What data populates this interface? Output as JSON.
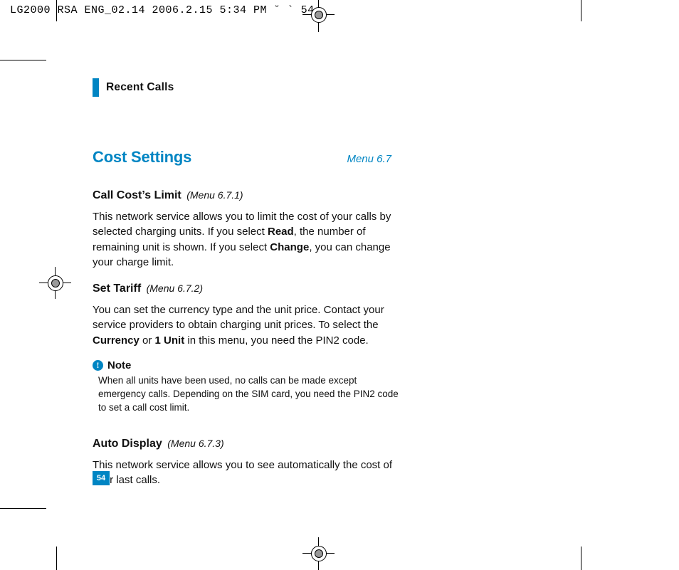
{
  "imposition": "LG2000 RSA ENG_02.14  2006.2.15 5:34 PM  ˘    ` 54",
  "chapter": "Recent Calls",
  "title": "Cost Settings",
  "title_menu": "Menu 6.7",
  "s1": {
    "title": "Call Cost’s Limit",
    "menu": "(Menu 6.7.1)",
    "p1a": "This network service allows you to limit the cost of your calls by selected charging units. If you select ",
    "b1": "Read",
    "p1b": ", the number of remaining unit is shown. If you select ",
    "b2": "Change",
    "p1c": ", you can change your charge limit."
  },
  "s2": {
    "title": "Set Tariff",
    "menu": "(Menu 6.7.2)",
    "p1a": "You can set the currency type and the unit price. Contact your service providers to obtain charging unit prices. To select the ",
    "b1": "Currency",
    "p1b": " or ",
    "b2": "1 Unit",
    "p1c": " in this menu, you need the PIN2 code."
  },
  "note": {
    "icon": "!",
    "label": "Note",
    "body": "When all units have been used, no calls can be made except emergency calls. Depending on the SIM card, you need the PIN2 code to set a call cost limit."
  },
  "s3": {
    "title": "Auto Display",
    "menu": "(Menu 6.7.3)",
    "body": "This network service allows you to see automatically the cost of your last calls."
  },
  "page_number": "54"
}
